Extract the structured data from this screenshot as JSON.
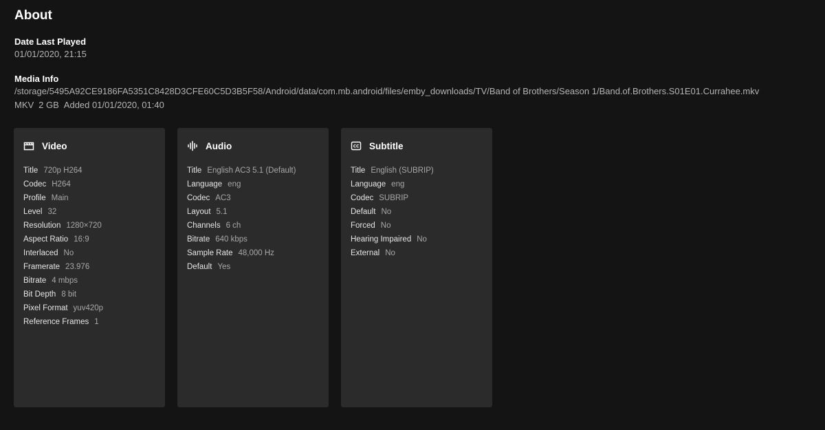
{
  "page": {
    "title": "About"
  },
  "last_played": {
    "label": "Date Last Played",
    "value": "01/01/2020, 21:15"
  },
  "media_info": {
    "label": "Media Info",
    "path": "/storage/5495A92CE9186FA5351C8428D3CFE60C5D3B5F58/Android/data/com.mb.android/files/emby_downloads/TV/Band of Brothers/Season 1/Band.of.Brothers.S01E01.Currahee.mkv",
    "container": "MKV",
    "size": "2 GB",
    "added": "Added 01/01/2020, 01:40"
  },
  "video": {
    "title": "Video",
    "icon": "film-icon",
    "rows": [
      {
        "k": "Title",
        "v": "720p H264"
      },
      {
        "k": "Codec",
        "v": "H264"
      },
      {
        "k": "Profile",
        "v": "Main"
      },
      {
        "k": "Level",
        "v": "32"
      },
      {
        "k": "Resolution",
        "v": "1280×720"
      },
      {
        "k": "Aspect Ratio",
        "v": "16:9"
      },
      {
        "k": "Interlaced",
        "v": "No"
      },
      {
        "k": "Framerate",
        "v": "23.976"
      },
      {
        "k": "Bitrate",
        "v": "4 mbps"
      },
      {
        "k": "Bit Depth",
        "v": "8 bit"
      },
      {
        "k": "Pixel Format",
        "v": "yuv420p"
      },
      {
        "k": "Reference Frames",
        "v": "1"
      }
    ]
  },
  "audio": {
    "title": "Audio",
    "icon": "audio-waveform-icon",
    "rows": [
      {
        "k": "Title",
        "v": "English AC3 5.1 (Default)"
      },
      {
        "k": "Language",
        "v": "eng"
      },
      {
        "k": "Codec",
        "v": "AC3"
      },
      {
        "k": "Layout",
        "v": "5.1"
      },
      {
        "k": "Channels",
        "v": "6 ch"
      },
      {
        "k": "Bitrate",
        "v": "640 kbps"
      },
      {
        "k": "Sample Rate",
        "v": "48,000 Hz"
      },
      {
        "k": "Default",
        "v": "Yes"
      }
    ]
  },
  "subtitle": {
    "title": "Subtitle",
    "icon": "closed-captions-icon",
    "rows": [
      {
        "k": "Title",
        "v": "English (SUBRIP)"
      },
      {
        "k": "Language",
        "v": "eng"
      },
      {
        "k": "Codec",
        "v": "SUBRIP"
      },
      {
        "k": "Default",
        "v": "No"
      },
      {
        "k": "Forced",
        "v": "No"
      },
      {
        "k": "Hearing Impaired",
        "v": "No"
      },
      {
        "k": "External",
        "v": "No"
      }
    ]
  },
  "colors": {
    "background": "#141414",
    "card": "#2b2b2b",
    "secondary_text": "#b4b4b4"
  }
}
